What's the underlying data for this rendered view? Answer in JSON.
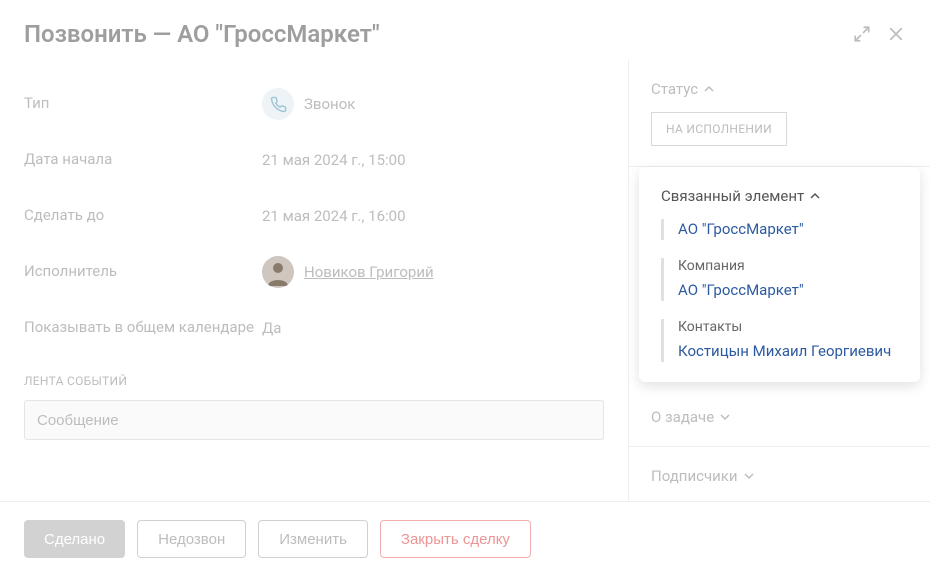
{
  "header": {
    "title": "Позвонить — АО \"ГроссМаркет\""
  },
  "fields": {
    "type": {
      "label": "Тип",
      "value": "Звонок"
    },
    "start_date": {
      "label": "Дата начала",
      "value": "21 мая 2024 г., 15:00"
    },
    "due_date": {
      "label": "Сделать до",
      "value": "21 мая 2024 г., 16:00"
    },
    "assignee": {
      "label": "Исполнитель",
      "value": "Новиков Григорий"
    },
    "shared_calendar": {
      "label": "Показывать в общем календаре",
      "value": "Да"
    }
  },
  "events": {
    "title": "ЛЕНТА СОБЫТИЙ",
    "message_placeholder": "Сообщение"
  },
  "footer": {
    "done": "Сделано",
    "no_answer": "Недозвон",
    "edit": "Изменить",
    "close_deal": "Закрыть сделку"
  },
  "sidebar": {
    "status": {
      "title": "Статус",
      "value": "НА ИСПОЛНЕНИИ"
    },
    "related": {
      "title": "Связанный элемент",
      "primary": "АО \"ГроссМаркет\"",
      "company_label": "Компания",
      "company_value": "АО \"ГроссМаркет\"",
      "contacts_label": "Контакты",
      "contacts_value": "Костицын Михаил Георгиевич"
    },
    "about": {
      "title": "О задаче"
    },
    "subscribers": {
      "title": "Подписчики"
    }
  }
}
